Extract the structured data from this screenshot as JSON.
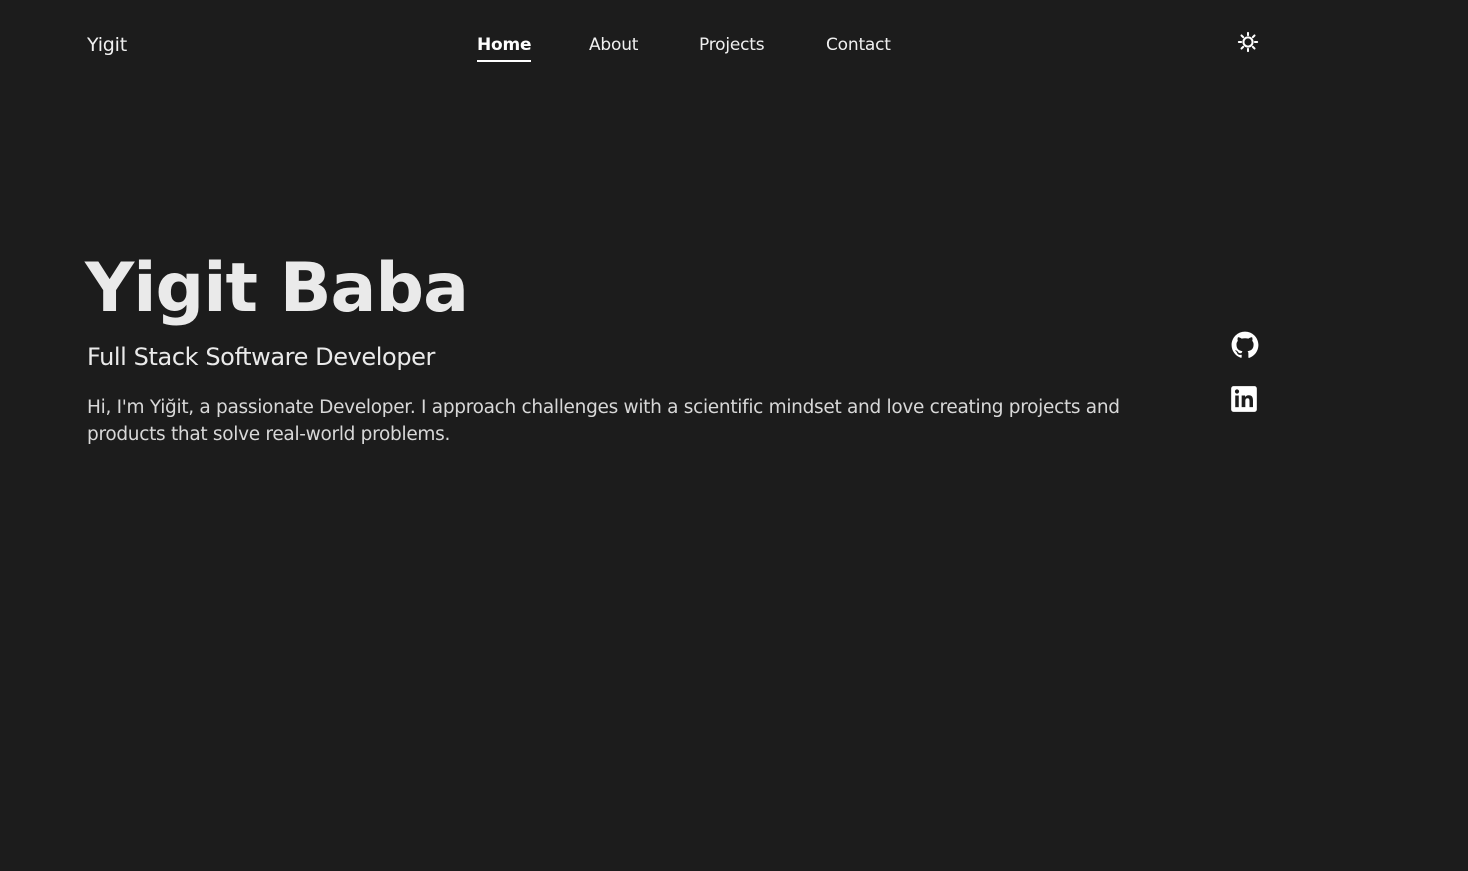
{
  "header": {
    "brand": "Yigit",
    "nav": [
      {
        "label": "Home",
        "active": true
      },
      {
        "label": "About",
        "active": false
      },
      {
        "label": "Projects",
        "active": false
      },
      {
        "label": "Contact",
        "active": false
      }
    ],
    "theme_toggle_icon": "sun-icon"
  },
  "hero": {
    "name": "Yigit Baba",
    "title": "Full Stack Software Developer",
    "intro": "Hi, I'm Yiğit, a passionate Developer. I approach challenges with a scientific mindset and love creating projects and products that solve real-world problems."
  },
  "social": [
    {
      "icon": "github-icon"
    },
    {
      "icon": "linkedin-icon"
    }
  ],
  "colors": {
    "background": "#1c1c1c",
    "text": "#ececec",
    "accent": "#ffffff"
  }
}
